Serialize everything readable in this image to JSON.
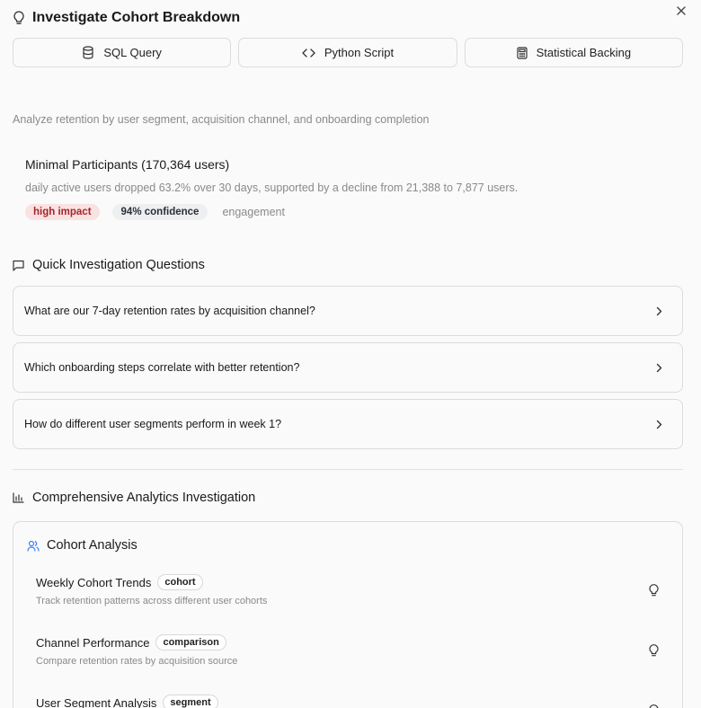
{
  "header": {
    "title": "Investigate Cohort Breakdown",
    "title_icon": "lightbulb-icon",
    "close_icon": "close-icon"
  },
  "actions": [
    {
      "label": "SQL Query",
      "icon": "database-icon"
    },
    {
      "label": "Python Script",
      "icon": "code-icon"
    },
    {
      "label": "Statistical Backing",
      "icon": "calculator-icon"
    }
  ],
  "description": "Analyze retention by user segment, acquisition channel, and onboarding completion",
  "finding": {
    "title": "Minimal Participants (170,364 users)",
    "summary": "daily active users dropped 63.2% over 30 days, supported by a decline from 21,388 to 7,877 users.",
    "impact": "high impact",
    "confidence": "94% confidence",
    "category": "engagement",
    "colors": {
      "impact_bg": "#fbe2e2",
      "impact_text": "#a3262a"
    }
  },
  "quick_questions": {
    "heading": "Quick Investigation Questions",
    "icon": "message-square-icon",
    "items": [
      {
        "text": "What are our 7-day retention rates by acquisition channel?"
      },
      {
        "text": "Which onboarding steps correlate with better retention?"
      },
      {
        "text": "How do different user segments perform in week 1?"
      }
    ]
  },
  "analytics": {
    "heading": "Comprehensive Analytics Investigation",
    "icon": "bar-chart-icon",
    "card": {
      "title": "Cohort Analysis",
      "icon": "users-icon",
      "accent": "#3b82f6",
      "items": [
        {
          "title": "Weekly Cohort Trends",
          "tag": "cohort",
          "desc": "Track retention patterns across different user cohorts"
        },
        {
          "title": "Channel Performance",
          "tag": "comparison",
          "desc": "Compare retention rates by acquisition source"
        },
        {
          "title": "User Segment Analysis",
          "tag": "segment",
          "desc": ""
        }
      ]
    }
  }
}
